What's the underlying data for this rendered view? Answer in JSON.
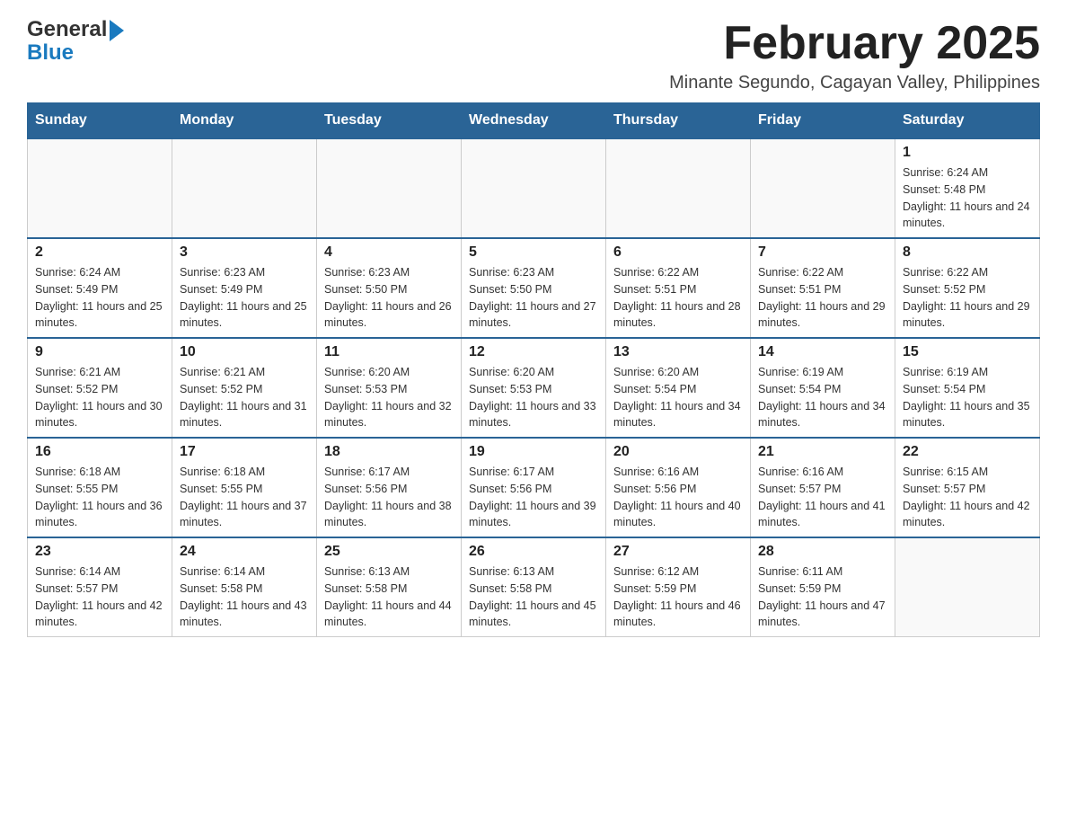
{
  "header": {
    "logo_general": "General",
    "logo_blue": "Blue",
    "month_title": "February 2025",
    "location": "Minante Segundo, Cagayan Valley, Philippines"
  },
  "days_of_week": [
    "Sunday",
    "Monday",
    "Tuesday",
    "Wednesday",
    "Thursday",
    "Friday",
    "Saturday"
  ],
  "weeks": [
    [
      {
        "day": "",
        "info": ""
      },
      {
        "day": "",
        "info": ""
      },
      {
        "day": "",
        "info": ""
      },
      {
        "day": "",
        "info": ""
      },
      {
        "day": "",
        "info": ""
      },
      {
        "day": "",
        "info": ""
      },
      {
        "day": "1",
        "info": "Sunrise: 6:24 AM\nSunset: 5:48 PM\nDaylight: 11 hours and 24 minutes."
      }
    ],
    [
      {
        "day": "2",
        "info": "Sunrise: 6:24 AM\nSunset: 5:49 PM\nDaylight: 11 hours and 25 minutes."
      },
      {
        "day": "3",
        "info": "Sunrise: 6:23 AM\nSunset: 5:49 PM\nDaylight: 11 hours and 25 minutes."
      },
      {
        "day": "4",
        "info": "Sunrise: 6:23 AM\nSunset: 5:50 PM\nDaylight: 11 hours and 26 minutes."
      },
      {
        "day": "5",
        "info": "Sunrise: 6:23 AM\nSunset: 5:50 PM\nDaylight: 11 hours and 27 minutes."
      },
      {
        "day": "6",
        "info": "Sunrise: 6:22 AM\nSunset: 5:51 PM\nDaylight: 11 hours and 28 minutes."
      },
      {
        "day": "7",
        "info": "Sunrise: 6:22 AM\nSunset: 5:51 PM\nDaylight: 11 hours and 29 minutes."
      },
      {
        "day": "8",
        "info": "Sunrise: 6:22 AM\nSunset: 5:52 PM\nDaylight: 11 hours and 29 minutes."
      }
    ],
    [
      {
        "day": "9",
        "info": "Sunrise: 6:21 AM\nSunset: 5:52 PM\nDaylight: 11 hours and 30 minutes."
      },
      {
        "day": "10",
        "info": "Sunrise: 6:21 AM\nSunset: 5:52 PM\nDaylight: 11 hours and 31 minutes."
      },
      {
        "day": "11",
        "info": "Sunrise: 6:20 AM\nSunset: 5:53 PM\nDaylight: 11 hours and 32 minutes."
      },
      {
        "day": "12",
        "info": "Sunrise: 6:20 AM\nSunset: 5:53 PM\nDaylight: 11 hours and 33 minutes."
      },
      {
        "day": "13",
        "info": "Sunrise: 6:20 AM\nSunset: 5:54 PM\nDaylight: 11 hours and 34 minutes."
      },
      {
        "day": "14",
        "info": "Sunrise: 6:19 AM\nSunset: 5:54 PM\nDaylight: 11 hours and 34 minutes."
      },
      {
        "day": "15",
        "info": "Sunrise: 6:19 AM\nSunset: 5:54 PM\nDaylight: 11 hours and 35 minutes."
      }
    ],
    [
      {
        "day": "16",
        "info": "Sunrise: 6:18 AM\nSunset: 5:55 PM\nDaylight: 11 hours and 36 minutes."
      },
      {
        "day": "17",
        "info": "Sunrise: 6:18 AM\nSunset: 5:55 PM\nDaylight: 11 hours and 37 minutes."
      },
      {
        "day": "18",
        "info": "Sunrise: 6:17 AM\nSunset: 5:56 PM\nDaylight: 11 hours and 38 minutes."
      },
      {
        "day": "19",
        "info": "Sunrise: 6:17 AM\nSunset: 5:56 PM\nDaylight: 11 hours and 39 minutes."
      },
      {
        "day": "20",
        "info": "Sunrise: 6:16 AM\nSunset: 5:56 PM\nDaylight: 11 hours and 40 minutes."
      },
      {
        "day": "21",
        "info": "Sunrise: 6:16 AM\nSunset: 5:57 PM\nDaylight: 11 hours and 41 minutes."
      },
      {
        "day": "22",
        "info": "Sunrise: 6:15 AM\nSunset: 5:57 PM\nDaylight: 11 hours and 42 minutes."
      }
    ],
    [
      {
        "day": "23",
        "info": "Sunrise: 6:14 AM\nSunset: 5:57 PM\nDaylight: 11 hours and 42 minutes."
      },
      {
        "day": "24",
        "info": "Sunrise: 6:14 AM\nSunset: 5:58 PM\nDaylight: 11 hours and 43 minutes."
      },
      {
        "day": "25",
        "info": "Sunrise: 6:13 AM\nSunset: 5:58 PM\nDaylight: 11 hours and 44 minutes."
      },
      {
        "day": "26",
        "info": "Sunrise: 6:13 AM\nSunset: 5:58 PM\nDaylight: 11 hours and 45 minutes."
      },
      {
        "day": "27",
        "info": "Sunrise: 6:12 AM\nSunset: 5:59 PM\nDaylight: 11 hours and 46 minutes."
      },
      {
        "day": "28",
        "info": "Sunrise: 6:11 AM\nSunset: 5:59 PM\nDaylight: 11 hours and 47 minutes."
      },
      {
        "day": "",
        "info": ""
      }
    ]
  ]
}
